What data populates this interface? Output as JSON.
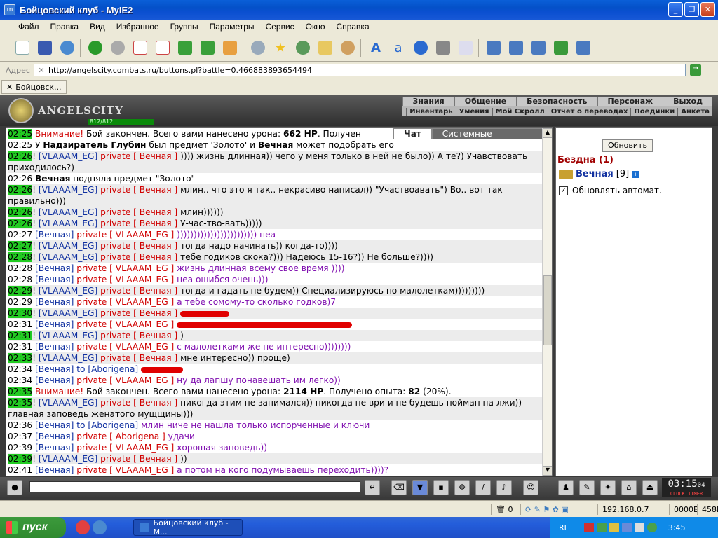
{
  "window": {
    "title": "Бойцовский клуб - MyIE2",
    "icon_name": "myie2-app-icon"
  },
  "menu": [
    "Файл",
    "Правка",
    "Вид",
    "Избранное",
    "Группы",
    "Параметры",
    "Сервис",
    "Окно",
    "Справка"
  ],
  "address": {
    "label": "Адрес",
    "url": "http://angelscity.combats.ru/buttons.pl?battle=0.466883893654494"
  },
  "links": {
    "tab_label": "Бойцовск..."
  },
  "game": {
    "logo_text": "ANGELSCITY",
    "nav_row1": [
      "Знания",
      "Общение",
      "Безопасность",
      "Персонаж",
      "Выход"
    ],
    "nav_row2": [
      "Инвентарь",
      "Умения",
      "Мой Скролл",
      "Отчет о переводах",
      "Поединки",
      "Анкета"
    ],
    "hp_text": "812/812",
    "hp_fraction": 1.0,
    "chat_tabs": {
      "chat": "Чат",
      "system": "Системные сообщения"
    }
  },
  "chat": [
    {
      "t": "02:25",
      "g": true,
      "type": "warn",
      "text": "Внимание! Бой закончен. Всего вами нанесено урона: ",
      "bold": "662 HP",
      "rest": ". Получен"
    },
    {
      "t": "02:25",
      "g": false,
      "type": "plain",
      "text": "У ",
      "b1": "Надзиратель Глубин",
      "mid": " был предмет 'Золото' и ",
      "b2": "Вечная",
      "rest": " может подобрать его"
    },
    {
      "t": "02:26",
      "g": true,
      "from": "VLAAAM_EG",
      "to": "Вечная",
      "msg": " )))) жизнь длинная)) чего у меня только в ней не было)) А те?) Учавствовать приходилось?)",
      "wrap": true
    },
    {
      "t": "02:26",
      "g": false,
      "type": "plain",
      "b1": "Вечная",
      "mid": " подняла предмет \"Золото\""
    },
    {
      "t": "02:26",
      "g": true,
      "from": "VLAAAM_EG",
      "to": "Вечная",
      "msg": " млин.. что это я так.. некрасиво написал)) \"Участвоавать\") Во.. вот так правильно)))",
      "wrap": true
    },
    {
      "t": "02:26",
      "g": true,
      "from": "VLAAAM_EG",
      "to": "Вечная",
      "msg": " млин))))))"
    },
    {
      "t": "02:26",
      "g": true,
      "from": "VLAAAM_EG",
      "to": "Вечная",
      "msg": " У-час-тво-вать)))))"
    },
    {
      "t": "02:27",
      "g": false,
      "from": "Вечная",
      "to": "VLAAAM_EG",
      "msg": " )))))))))))))))))))))))) неа",
      "pu": true
    },
    {
      "t": "02:27",
      "g": true,
      "from": "VLAAAM_EG",
      "to": "Вечная",
      "msg": " тогда надо начинать)) когда-то))))"
    },
    {
      "t": "02:28",
      "g": true,
      "from": "VLAAAM_EG",
      "to": "Вечная",
      "msg": " тебе годиков скока?))) Надеюсь 15-16?)) Не больше?))))"
    },
    {
      "t": "02:28",
      "g": false,
      "from": "Вечная",
      "to": "VLAAAM_EG",
      "msg": " жизнь длинная всему свое время ))))",
      "pu": true
    },
    {
      "t": "02:28",
      "g": false,
      "from": "Вечная",
      "to": "VLAAAM_EG",
      "msg": " неа ошибся очень)))",
      "pu": true
    },
    {
      "t": "02:29",
      "g": true,
      "from": "VLAAAM_EG",
      "to": "Вечная",
      "msg": " тогда и гадать не будем)) Специализируюсь по малолеткам)))))))))"
    },
    {
      "t": "02:29",
      "g": false,
      "from": "Вечная",
      "to": "VLAAAM_EG",
      "msg": " а тебе сомому-то сколько годков)7",
      "pu": true
    },
    {
      "t": "02:30",
      "g": true,
      "from": "VLAAAM_EG",
      "to": "Вечная",
      "msg": " ",
      "redact": 70
    },
    {
      "t": "02:31",
      "g": false,
      "from": "Вечная",
      "to": "VLAAAM_EG",
      "msg": " ",
      "redact": 250,
      "pu": true
    },
    {
      "t": "02:31",
      "g": true,
      "from": "VLAAAM_EG",
      "to": "Вечная",
      "msg": " )"
    },
    {
      "t": "02:31",
      "g": false,
      "from": "Вечная",
      "to": "VLAAAM_EG",
      "msg": " с малолетками же не интересно))))))))",
      "pu": true
    },
    {
      "t": "02:33",
      "g": true,
      "from": "VLAAAM_EG",
      "to": "Вечная",
      "msg": " мне интересно)) проще)"
    },
    {
      "t": "02:34",
      "g": false,
      "from": "Вечная",
      "toplain": "to [Aborigena]",
      "msg": " ",
      "redact": 60,
      "pu": true
    },
    {
      "t": "02:34",
      "g": false,
      "from": "Вечная",
      "to": "VLAAAM_EG",
      "msg": " ну да лапшу понавешать им легко))",
      "pu": true
    },
    {
      "t": "02:35",
      "g": true,
      "type": "warn",
      "text": "Внимание! Бой закончен. Всего вами нанесено урона: ",
      "bold": "2114 HP",
      "rest": ". Получено опыта: ",
      "bold2": "82",
      "rest2": " (20%)."
    },
    {
      "t": "02:35",
      "g": true,
      "from": "VLAAAM_EG",
      "to": "Вечная",
      "msg": " никогда этим не занимался)) никогда не ври и не будешь пойман на лжи)) главная заповедь женатого мущщины)))",
      "wrap": true
    },
    {
      "t": "02:36",
      "g": false,
      "from": "Вечная",
      "toplain": "to [Aborigena]",
      "msg": " млин ниче не нашла только испорченные и ключи",
      "pu": true
    },
    {
      "t": "02:37",
      "g": false,
      "from": "Вечная",
      "to": "Aborigena",
      "msg": " удачи",
      "pu": true
    },
    {
      "t": "02:39",
      "g": false,
      "from": "Вечная",
      "to": "VLAAAM_EG",
      "msg": " хорошая заповедь))",
      "pu": true
    },
    {
      "t": "02:39",
      "g": true,
      "from": "VLAAAM_EG",
      "to": "Вечная",
      "msg": " ))"
    },
    {
      "t": "02:41",
      "g": false,
      "from": "Вечная",
      "to": "VLAAAM_EG",
      "msg": " а потом на кого подумываешь переходить))))?",
      "pu": true
    }
  ],
  "panel": {
    "refresh_label": "Обновить",
    "location": "Бездна (1)",
    "user_name": "Вечная",
    "user_level": "[9]",
    "auto_label": "Обновлять автомат."
  },
  "clock": {
    "time": "03:15",
    "sub": "04",
    "labels": "CLOCK TIMER"
  },
  "status": {
    "blocked": "0",
    "ip": "192.168.0.7",
    "traffic": "0000B",
    "mem": "458M"
  },
  "taskbar": {
    "start": "пуск",
    "task": "Бойцовский клуб - M...",
    "lang": "RL",
    "time": "3:45"
  },
  "colors": {
    "timestamp_green": "#22cc22",
    "private_red": "#d00000",
    "name_blue": "#1030a0",
    "msg_purple": "#8010b0"
  }
}
